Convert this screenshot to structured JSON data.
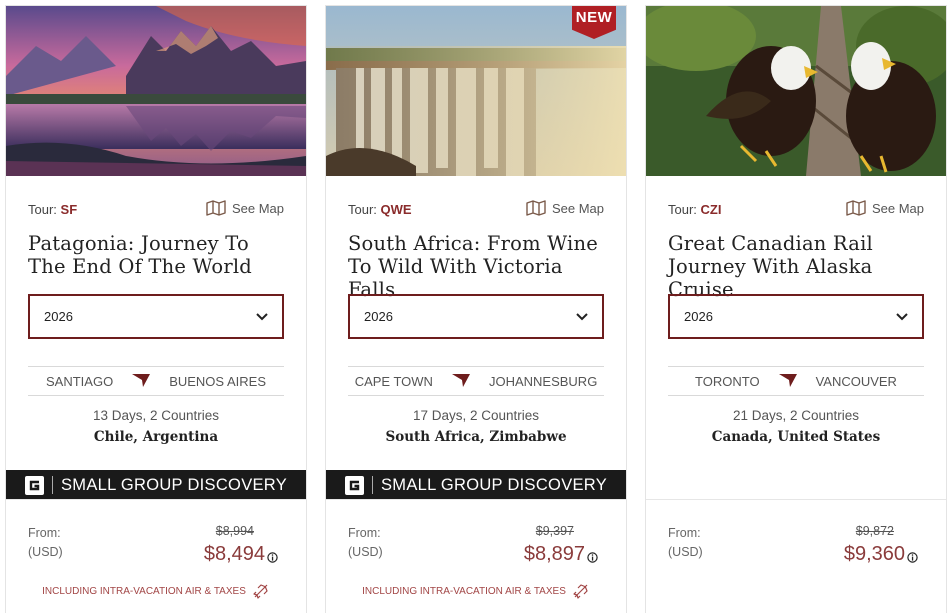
{
  "colors": {
    "accent": "#8a2b2b",
    "border": "#6e1d1d",
    "banner": "#1a1a1a",
    "badge": "#b01f24"
  },
  "cards": [
    {
      "image": "patagonia-mountains-photo",
      "badge": "",
      "tour_label": "Tour:",
      "tour_code": "SF",
      "see_map": "See Map",
      "title": "Patagonia: Journey To The End Of The World",
      "year": "2026",
      "route_from": "SANTIAGO",
      "route_to": "BUENOS AIRES",
      "duration": "13 Days, 2 Countries",
      "countries": "Chile, Argentina",
      "banner": "SMALL GROUP DISCOVERY",
      "from_label": "From:",
      "currency": "(USD)",
      "price_old": "$8,994",
      "price_new": "$8,494",
      "inclusion": "INCLUDING INTRA-VACATION AIR & TAXES"
    },
    {
      "image": "victoria-falls-photo",
      "badge": "NEW",
      "tour_label": "Tour:",
      "tour_code": "QWE",
      "see_map": "See Map",
      "title": "South Africa: From Wine To Wild With Victoria Falls",
      "year": "2026",
      "route_from": "CAPE TOWN",
      "route_to": "JOHANNESBURG",
      "duration": "17 Days, 2 Countries",
      "countries": "South Africa, Zimbabwe",
      "banner": "SMALL GROUP DISCOVERY",
      "from_label": "From:",
      "currency": "(USD)",
      "price_old": "$9,397",
      "price_new": "$8,897",
      "inclusion": "INCLUDING INTRA-VACATION AIR & TAXES"
    },
    {
      "image": "bald-eagles-photo",
      "badge": "",
      "tour_label": "Tour:",
      "tour_code": "CZI",
      "see_map": "See Map",
      "title": "Great Canadian Rail Journey With Alaska Cruise",
      "year": "2026",
      "route_from": "TORONTO",
      "route_to": "VANCOUVER",
      "duration": "21 Days, 2 Countries",
      "countries": "Canada, United States",
      "banner": "",
      "from_label": "From:",
      "currency": "(USD)",
      "price_old": "$9,872",
      "price_new": "$9,360",
      "inclusion": ""
    }
  ]
}
